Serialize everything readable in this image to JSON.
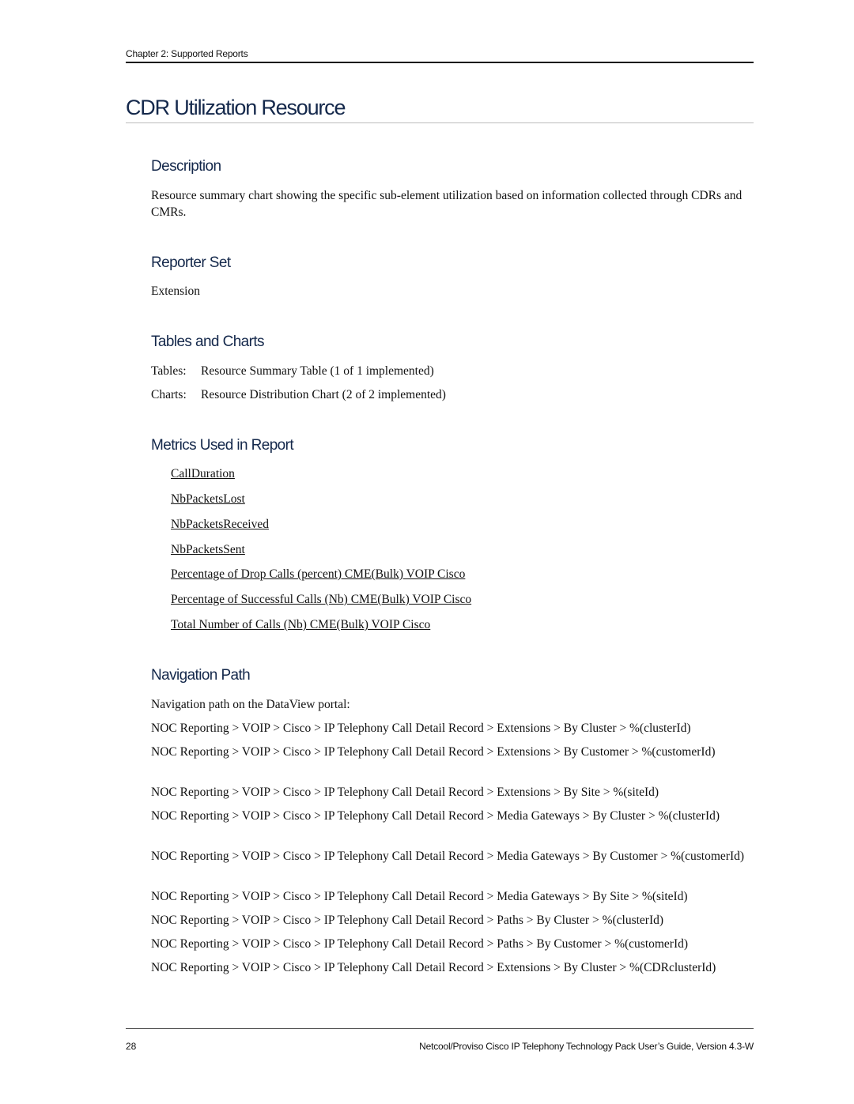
{
  "header": {
    "running_head": "Chapter 2: Supported Reports"
  },
  "title": "CDR Utilization Resource",
  "sections": {
    "description": {
      "heading": "Description",
      "text": "Resource summary chart showing the specific sub-element utilization based on information collected through CDRs and CMRs."
    },
    "reporter_set": {
      "heading": "Reporter Set",
      "text": "Extension"
    },
    "tables_charts": {
      "heading": "Tables and Charts",
      "rows": [
        {
          "label": "Tables:",
          "value": "Resource Summary Table (1 of 1 implemented)"
        },
        {
          "label": "Charts:",
          "value": "Resource Distribution Chart (2 of 2 implemented)"
        }
      ]
    },
    "metrics": {
      "heading": "Metrics Used in Report",
      "items": [
        "CallDuration",
        "NbPacketsLost",
        "NbPacketsReceived",
        "NbPacketsSent",
        "Percentage of Drop Calls (percent) CME(Bulk) VOIP Cisco",
        "Percentage of Successful Calls (Nb) CME(Bulk) VOIP Cisco",
        "Total Number of Calls (Nb) CME(Bulk) VOIP Cisco "
      ]
    },
    "navigation": {
      "heading": "Navigation Path",
      "intro": "Navigation path on the DataView portal:",
      "paths": [
        "NOC Reporting > VOIP > Cisco > IP Telephony Call Detail Record > Extensions > By Cluster > %(clusterId)",
        "NOC Reporting > VOIP > Cisco > IP Telephony Call Detail Record > Extensions > By Customer > %(customerId)",
        "NOC Reporting > VOIP > Cisco > IP Telephony Call Detail Record > Extensions > By Site > %(siteId)",
        "NOC Reporting > VOIP > Cisco > IP Telephony Call Detail Record > Media Gateways > By Cluster > %(clusterId)",
        "NOC Reporting > VOIP > Cisco > IP Telephony Call Detail Record > Media Gateways > By Customer > %(customerId)",
        "NOC Reporting > VOIP > Cisco > IP Telephony Call Detail Record > Media Gateways > By Site > %(siteId)",
        "NOC Reporting > VOIP > Cisco > IP Telephony Call Detail Record > Paths > By Cluster > %(clusterId)",
        "NOC Reporting > VOIP > Cisco > IP Telephony Call Detail Record > Paths > By Customer > %(customerId)",
        "NOC Reporting > VOIP > Cisco > IP Telephony Call Detail Record > Extensions > By Cluster > %(CDRclusterId)"
      ]
    }
  },
  "footer": {
    "page_number": "28",
    "doc_title": "Netcool/Proviso Cisco IP Telephony Technology Pack User’s Guide, Version 4.3-W"
  },
  "colors": {
    "heading": "#14284b",
    "body_text": "#111111"
  }
}
